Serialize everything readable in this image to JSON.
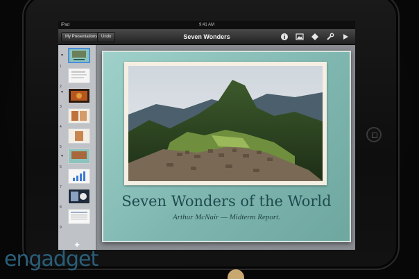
{
  "status_bar": {
    "carrier": "iPad",
    "time": "9:41 AM"
  },
  "toolbar": {
    "my_presentations_label": "My Presentations",
    "undo_label": "Undo",
    "title": "Seven Wonders",
    "icons": [
      "info-icon",
      "media-icon",
      "shapes-icon",
      "tools-icon",
      "play-icon"
    ]
  },
  "sidebar": {
    "slides": [
      {
        "number": "1",
        "selected": true
      },
      {
        "number": "2",
        "selected": false
      },
      {
        "number": "3",
        "selected": false
      },
      {
        "number": "4",
        "selected": false
      },
      {
        "number": "5",
        "selected": false
      },
      {
        "number": "6",
        "selected": false
      },
      {
        "number": "7",
        "selected": false
      },
      {
        "number": "8",
        "selected": false
      },
      {
        "number": "9",
        "selected": false
      }
    ],
    "add_label": "+"
  },
  "slide": {
    "title": "Seven Wonders of the World",
    "subtitle": "Arthur McNair — Midterm Report."
  },
  "watermark": "engadget",
  "colors": {
    "slide_bg": "#8cc4bd",
    "title_text": "#1f4b4f",
    "selection": "#4b8dd9"
  }
}
